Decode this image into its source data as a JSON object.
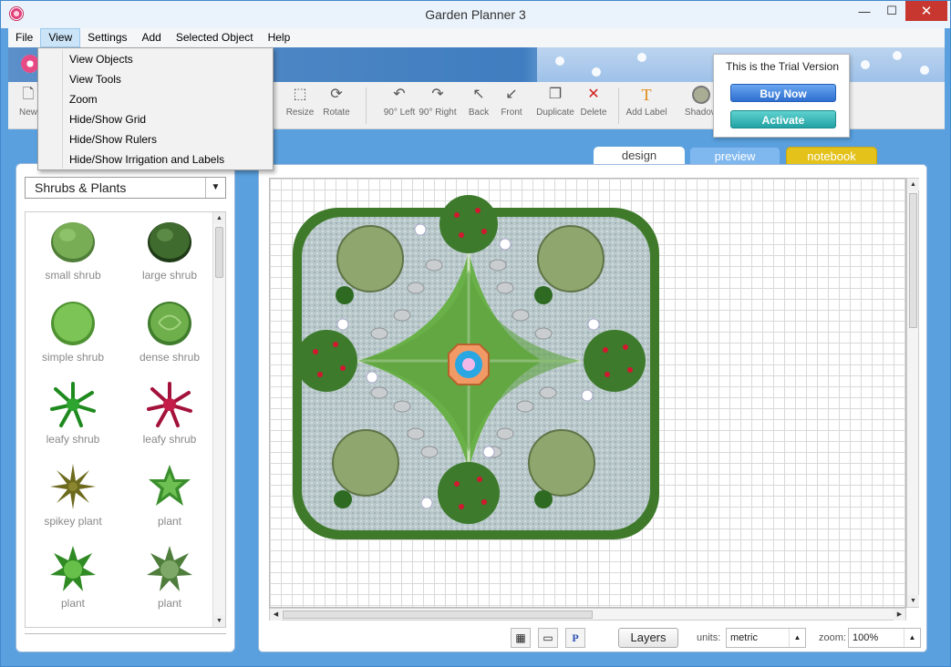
{
  "window": {
    "title": "Garden Planner 3"
  },
  "window_controls": {
    "minimize": "—",
    "maximize": "☐",
    "close": "✕"
  },
  "menubar": {
    "items": [
      {
        "label": "File"
      },
      {
        "label": "View"
      },
      {
        "label": "Settings"
      },
      {
        "label": "Add"
      },
      {
        "label": "Selected Object"
      },
      {
        "label": "Help"
      }
    ]
  },
  "view_menu": {
    "items": [
      {
        "label": "View Objects"
      },
      {
        "label": "View Tools"
      },
      {
        "label": "Zoom"
      },
      {
        "label": "Hide/Show Grid"
      },
      {
        "label": "Hide/Show Rulers"
      },
      {
        "label": "Hide/Show Irrigation and Labels"
      }
    ]
  },
  "toolbar": {
    "new": "New",
    "resize": "Resize",
    "rotate": "Rotate",
    "left90": "90° Left",
    "right90": "90° Right",
    "back": "Back",
    "front": "Front",
    "duplicate": "Duplicate",
    "delete": "Delete",
    "add_label": "Add Label",
    "shadow": "Shadow"
  },
  "trial": {
    "message": "This is the Trial Version",
    "buy_label": "Buy Now",
    "activate_label": "Activate"
  },
  "tabs": {
    "design": "design",
    "preview": "preview",
    "notebook": "notebook"
  },
  "category": {
    "selected": "Shrubs & Plants",
    "arrow": "▼"
  },
  "plants": [
    {
      "label": "small shrub"
    },
    {
      "label": "large shrub"
    },
    {
      "label": "simple shrub"
    },
    {
      "label": "dense shrub"
    },
    {
      "label": "leafy shrub"
    },
    {
      "label": "leafy shrub"
    },
    {
      "label": "spikey plant"
    },
    {
      "label": "plant"
    },
    {
      "label": "plant"
    },
    {
      "label": "plant"
    }
  ],
  "bottom": {
    "layers_label": "Layers",
    "units_label": "units:",
    "units_value": "metric",
    "zoom_label": "zoom:",
    "zoom_value": "100%",
    "p_label": "P"
  },
  "colors": {
    "accent": "#5aa0de",
    "buy": "#2e6fd0",
    "activate": "#23a2a4",
    "notebook_tab": "#e4c21a",
    "preview_tab": "#7fb8ef"
  }
}
